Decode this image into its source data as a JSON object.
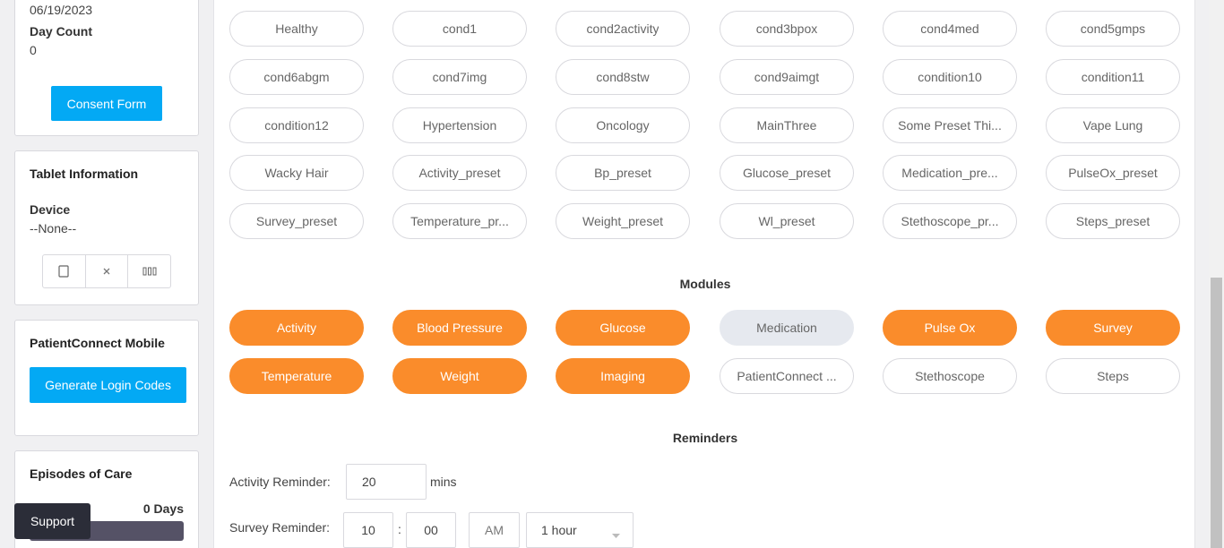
{
  "sidebar": {
    "patient": {
      "date": "06/19/2023",
      "day_count_label": "Day Count",
      "day_count_value": "0",
      "consent_button": "Consent Form"
    },
    "tablet": {
      "title": "Tablet Information",
      "device_label": "Device",
      "device_value": "--None--"
    },
    "mobile": {
      "title": "PatientConnect Mobile",
      "generate_button": "Generate Login Codes"
    },
    "episodes": {
      "title": "Episodes of Care",
      "days": "0 Days"
    }
  },
  "presets": [
    "Healthy",
    "cond1",
    "cond2activity",
    "cond3bpox",
    "cond4med",
    "cond5gmps",
    "cond6abgm",
    "cond7img",
    "cond8stw",
    "cond9aimgt",
    "condition10",
    "condition11",
    "condition12",
    "Hypertension",
    "Oncology",
    "MainThree",
    "Some Preset Thi...",
    "Vape Lung",
    "Wacky Hair",
    "Activity_preset",
    "Bp_preset",
    "Glucose_preset",
    "Medication_pre...",
    "PulseOx_preset",
    "Survey_preset",
    "Temperature_pr...",
    "Weight_preset",
    "Wl_preset",
    "Stethoscope_pr...",
    "Steps_preset"
  ],
  "modules_title": "Modules",
  "modules": [
    {
      "label": "Activity",
      "state": "orange"
    },
    {
      "label": "Blood Pressure",
      "state": "orange"
    },
    {
      "label": "Glucose",
      "state": "orange"
    },
    {
      "label": "Medication",
      "state": "grey"
    },
    {
      "label": "Pulse Ox",
      "state": "orange"
    },
    {
      "label": "Survey",
      "state": "orange"
    },
    {
      "label": "Temperature",
      "state": "orange"
    },
    {
      "label": "Weight",
      "state": "orange"
    },
    {
      "label": "Imaging",
      "state": "orange"
    },
    {
      "label": "PatientConnect ...",
      "state": "outline"
    },
    {
      "label": "Stethoscope",
      "state": "outline"
    },
    {
      "label": "Steps",
      "state": "outline"
    }
  ],
  "reminders": {
    "title": "Reminders",
    "activity_label": "Activity Reminder:",
    "activity_value": "20",
    "activity_unit": "mins",
    "survey_label": "Survey Reminder:",
    "survey_hour": "10",
    "survey_sep": ":",
    "survey_minute": "00",
    "survey_ampm": "AM",
    "survey_interval": "1 hour"
  },
  "support_label": "Support",
  "colors": {
    "accent_blue": "#03a9f4",
    "module_on": "#fa8c2b",
    "module_off": "#e6e9ef"
  }
}
